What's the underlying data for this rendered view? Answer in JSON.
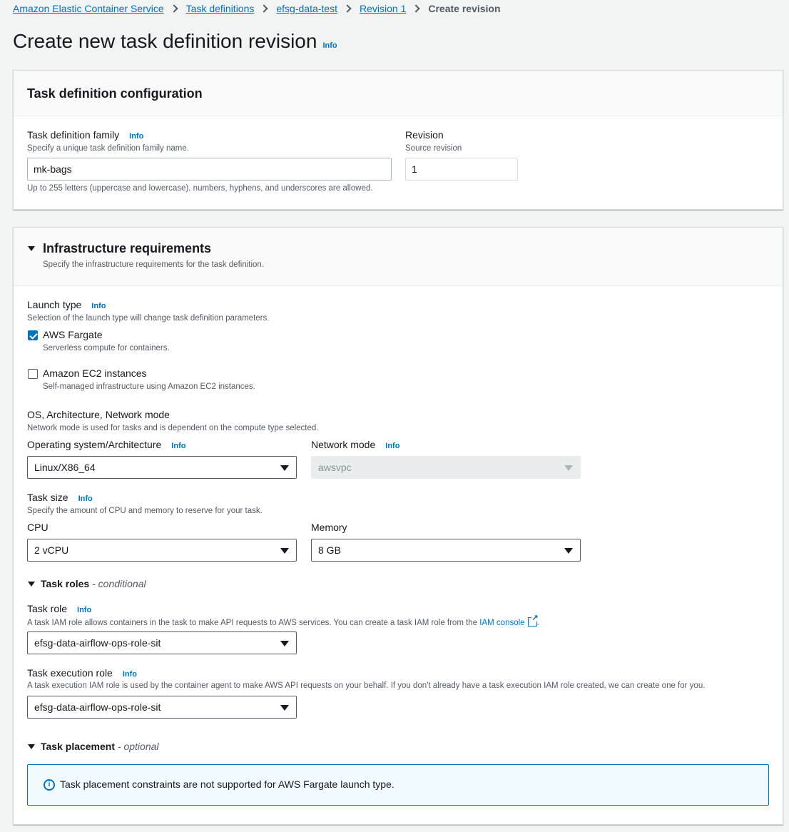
{
  "breadcrumb": {
    "items": [
      "Amazon Elastic Container Service",
      "Task definitions",
      "efsg-data-test",
      "Revision 1"
    ],
    "current": "Create revision"
  },
  "page": {
    "title": "Create new task definition revision",
    "info": "Info"
  },
  "task_def_config": {
    "title": "Task definition configuration",
    "family_label": "Task definition family",
    "info": "Info",
    "family_desc": "Specify a unique task definition family name.",
    "family_value": "mk-bags",
    "family_constraint": "Up to 255 letters (uppercase and lowercase), numbers, hyphens, and underscores are allowed.",
    "revision_label": "Revision",
    "revision_desc": "Source revision",
    "revision_value": "1"
  },
  "infra": {
    "title": "Infrastructure requirements",
    "desc": "Specify the infrastructure requirements for the task definition.",
    "launch_type": {
      "label": "Launch type",
      "info": "Info",
      "desc": "Selection of the launch type will change task definition parameters.",
      "fargate_label": "AWS Fargate",
      "fargate_desc": "Serverless compute for containers.",
      "fargate_checked": true,
      "ec2_label": "Amazon EC2 instances",
      "ec2_desc": "Self-managed infrastructure using Amazon EC2 instances.",
      "ec2_checked": false
    },
    "os_arch": {
      "label": "OS, Architecture, Network mode",
      "desc": "Network mode is used for tasks and is dependent on the compute type selected.",
      "os_label": "Operating system/Architecture",
      "os_info": "Info",
      "os_value": "Linux/X86_64",
      "network_label": "Network mode",
      "network_info": "Info",
      "network_value": "awsvpc"
    },
    "task_size": {
      "label": "Task size",
      "info": "Info",
      "desc": "Specify the amount of CPU and memory to reserve for your task.",
      "cpu_label": "CPU",
      "cpu_value": "2 vCPU",
      "memory_label": "Memory",
      "memory_value": "8 GB"
    },
    "task_roles": {
      "title": "Task roles",
      "suffix": "- conditional",
      "role_label": "Task role",
      "role_info": "Info",
      "role_desc": "A task IAM role allows containers in the task to make API requests to AWS services. You can create a task IAM role from the",
      "role_link": "IAM console",
      "role_value": "efsg-data-airflow-ops-role-sit",
      "exec_label": "Task execution role",
      "exec_info": "Info",
      "exec_desc": "A task execution IAM role is used by the container agent to make AWS API requests on your behalf. If you don't already have a task execution IAM role created, we can create one for you.",
      "exec_value": "efsg-data-airflow-ops-role-sit"
    },
    "task_placement": {
      "title": "Task placement",
      "suffix": "- optional",
      "alert": "Task placement constraints are not supported for AWS Fargate launch type.",
      "alert_icon": "i"
    }
  }
}
